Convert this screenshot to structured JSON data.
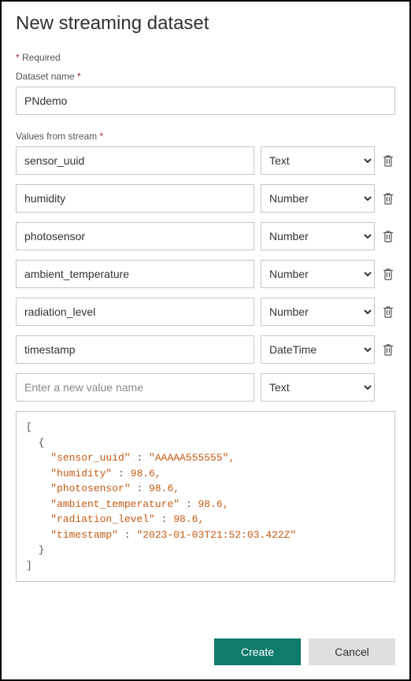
{
  "title": "New streaming dataset",
  "required_label": "Required",
  "dataset_name": {
    "label": "Dataset name",
    "value": "PNdemo"
  },
  "values_label": "Values from stream",
  "type_options": [
    "Text",
    "Number",
    "DateTime"
  ],
  "values": [
    {
      "name": "sensor_uuid",
      "type": "Text"
    },
    {
      "name": "humidity",
      "type": "Number"
    },
    {
      "name": "photosensor",
      "type": "Number"
    },
    {
      "name": "ambient_temperature",
      "type": "Number"
    },
    {
      "name": "radiation_level",
      "type": "Number"
    },
    {
      "name": "timestamp",
      "type": "DateTime"
    }
  ],
  "new_value": {
    "placeholder": "Enter a new value name",
    "type": "Text"
  },
  "preview": {
    "sensor_uuid": "AAAAA555555",
    "humidity": 98.6,
    "photosensor": 98.6,
    "ambient_temperature": 98.6,
    "radiation_level": 98.6,
    "timestamp": "2023-01-03T21:52:03.422Z"
  },
  "buttons": {
    "create": "Create",
    "cancel": "Cancel"
  }
}
